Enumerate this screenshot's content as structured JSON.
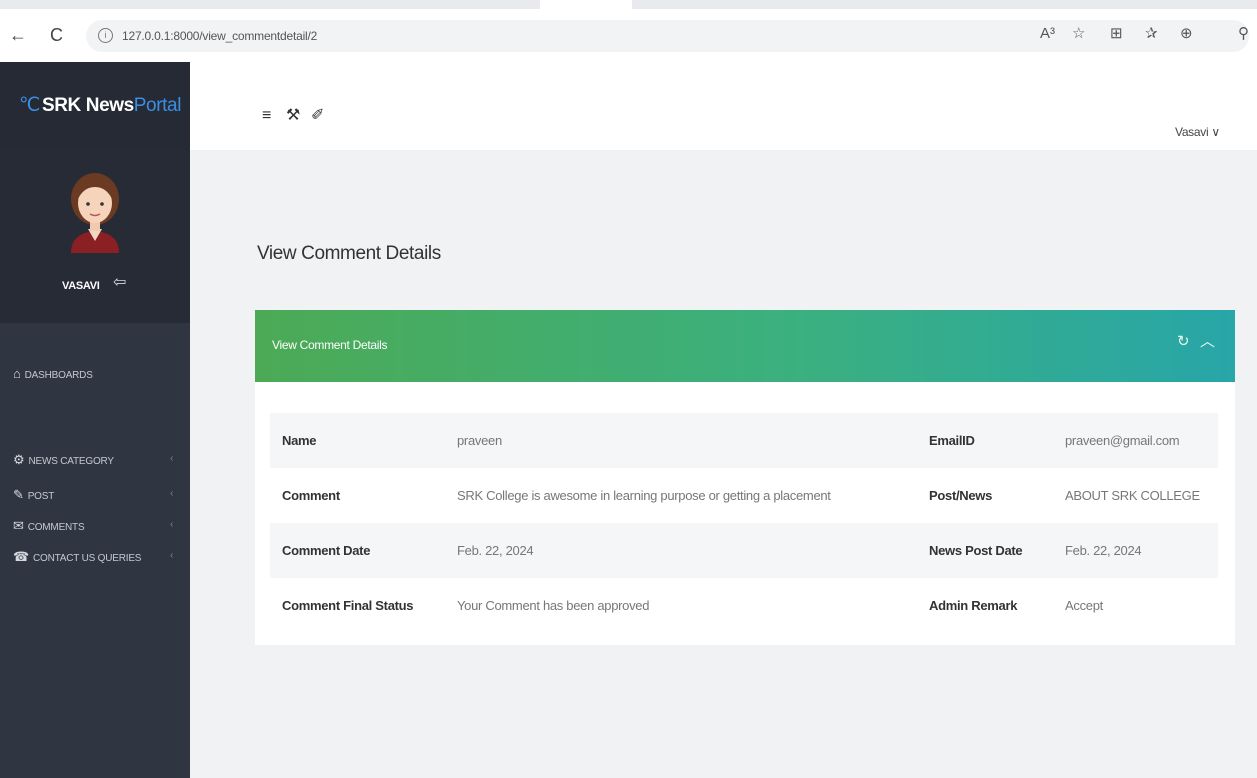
{
  "browser": {
    "back_icon": "←",
    "refresh_icon": "C",
    "info_icon": "i",
    "url": "127.0.0.1:8000/view_commentdetail/2",
    "icons": [
      "A³",
      "☆",
      "⊞",
      "✰",
      "⊕",
      "⚲"
    ]
  },
  "sidebar": {
    "brand_logo_glyph": "℃",
    "brand_main": "SRK News",
    "brand_accent": "Portal",
    "username": "VASAVI",
    "logout_icon": "⇦",
    "menu": [
      {
        "icon": "⌂",
        "label": "DASHBOARDS",
        "arrow": ""
      },
      {
        "icon": "⚙",
        "label": "NEWS CATEGORY",
        "arrow": "‹"
      },
      {
        "icon": "✎",
        "label": "POST",
        "arrow": "‹"
      },
      {
        "icon": "✉",
        "label": "COMMENTS",
        "arrow": "‹"
      },
      {
        "icon": "☎",
        "label": "CONTACT US QUERIES",
        "arrow": "‹"
      }
    ]
  },
  "topbar": {
    "menu_icon": "≡",
    "wrench_icon": "⚒",
    "brush_icon": "✐",
    "user_label": "Vasavi ∨"
  },
  "main": {
    "page_title": "View Comment Details",
    "card_title": "View Comment Details",
    "card_tools": [
      "↻",
      "︿"
    ],
    "rows": [
      [
        "Name",
        "praveen",
        "EmailID",
        "praveen@gmail.com"
      ],
      [
        "Comment",
        "SRK College is awesome in learning purpose or getting a placement",
        "Post/News",
        "ABOUT SRK COLLEGE"
      ],
      [
        "Comment Date",
        "Feb. 22, 2024",
        "News Post Date",
        "Feb. 22, 2024"
      ],
      [
        "Comment Final Status",
        "Your Comment has been approved",
        "Admin Remark",
        "Accept"
      ]
    ]
  },
  "colors": {
    "sidebar_bg": "#2f3541",
    "brand_accent": "#3a8ee6",
    "card_header_start": "#4caa56",
    "card_header_end": "#28a6a8",
    "content_bg": "#f0f2f4"
  }
}
